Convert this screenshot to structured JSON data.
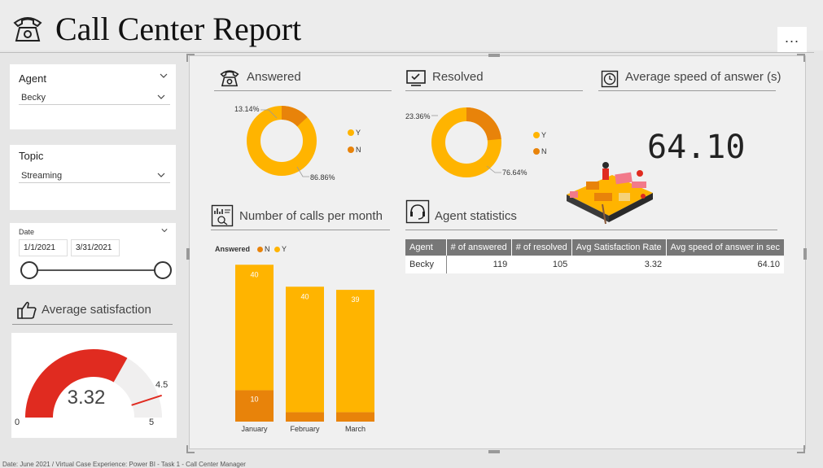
{
  "header": {
    "title": "Call Center Report",
    "more_label": "..."
  },
  "slicers": {
    "agent": {
      "title": "Agent",
      "value": "Becky"
    },
    "topic": {
      "title": "Topic",
      "value": "Streaming"
    },
    "date": {
      "title": "Date",
      "start": "1/1/2021",
      "end": "3/31/2021"
    }
  },
  "satisfaction": {
    "title": "Average satisfaction",
    "value": "3.32",
    "min": "0",
    "max": "5",
    "target": "4.5",
    "fraction": 0.664,
    "target_fraction": 0.9
  },
  "answered": {
    "title": "Answered",
    "legend": [
      "Y",
      "N"
    ],
    "pct_y": "86.86%",
    "pct_n": "13.14%",
    "frac_n": 0.1314
  },
  "resolved": {
    "title": "Resolved",
    "legend": [
      "Y",
      "N"
    ],
    "pct_y": "76.64%",
    "pct_n": "23.36%",
    "frac_n": 0.2336
  },
  "speed": {
    "title": "Average speed of answer (s)",
    "value": "64.10"
  },
  "monthly": {
    "title": "Number of calls per month",
    "legend_title": "Answered",
    "legend": [
      "N",
      "Y"
    ]
  },
  "agent_stats": {
    "title": "Agent statistics",
    "columns": [
      "Agent",
      "# of answered",
      "# of resolved",
      "Avg Satisfaction Rate",
      "Avg speed of answer in sec"
    ],
    "rows": [
      [
        "Becky",
        "119",
        "105",
        "3.32",
        "64.10"
      ]
    ]
  },
  "footer": {
    "text": "Date: June 2021 / Virtual Case Experience: Power BI - Task 1 - Call Center Manager"
  },
  "colors": {
    "y": "#ffb400",
    "n": "#e8830a",
    "gauge": "#e02b20",
    "track": "#f0efef"
  },
  "chart_data": {
    "type": "bar",
    "categories": [
      "January",
      "February",
      "March"
    ],
    "series": [
      {
        "name": "N",
        "values": [
          10,
          3,
          3
        ]
      },
      {
        "name": "Y",
        "values": [
          40,
          40,
          39
        ]
      }
    ],
    "ylim": [
      0,
      55
    ]
  }
}
